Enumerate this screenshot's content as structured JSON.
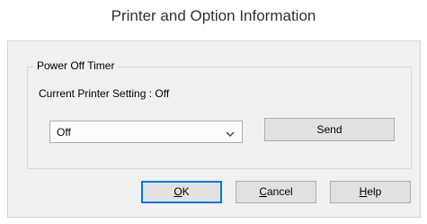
{
  "dialog": {
    "title": "Printer and Option Information"
  },
  "power_off_timer": {
    "group_label": "Power Off Timer",
    "current_setting_label": "Current Printer Setting : Off",
    "select_value": "Off",
    "send_label": "Send"
  },
  "buttons": {
    "ok_access": "O",
    "ok_rest": "K",
    "cancel_access": "C",
    "cancel_rest": "ancel",
    "help_access": "H",
    "help_rest": "elp"
  },
  "icons": {
    "dropdown": "chevron-down-icon"
  }
}
